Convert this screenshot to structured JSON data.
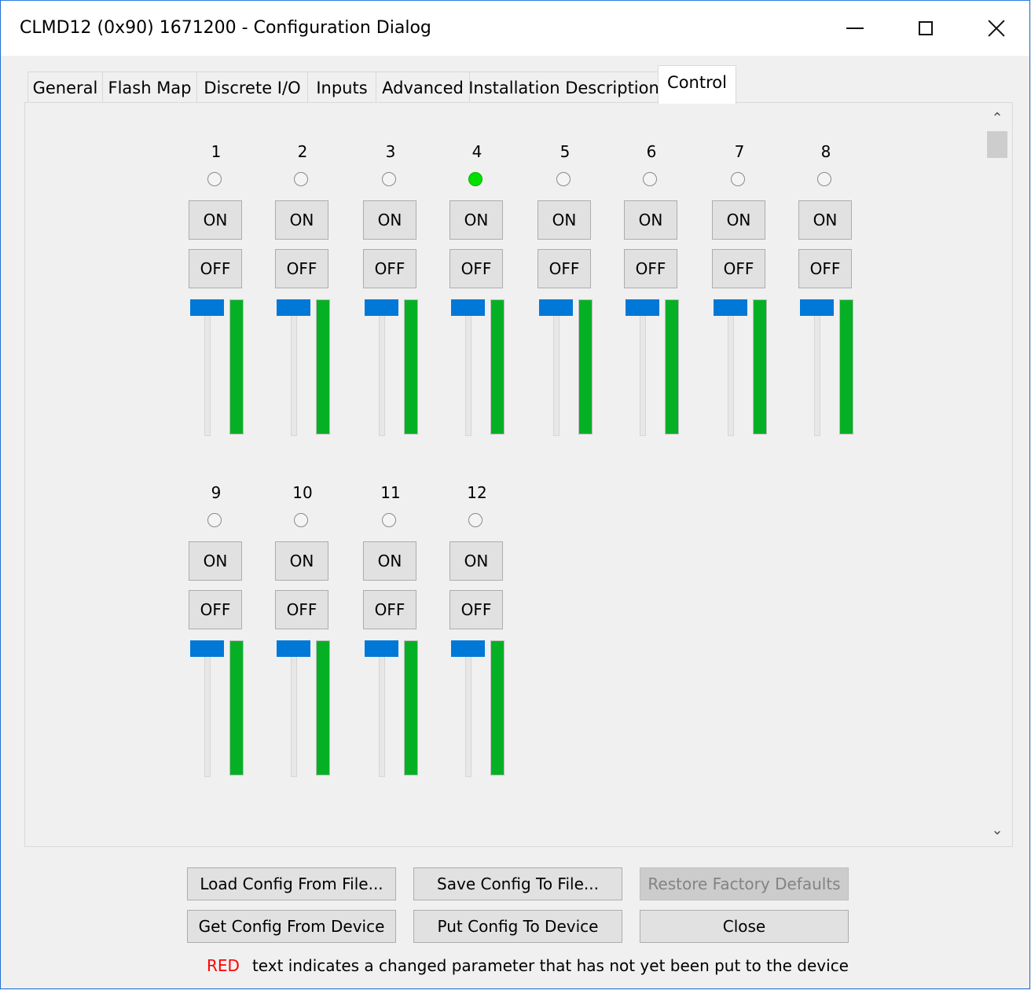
{
  "window": {
    "title": "CLMD12 (0x90) 1671200 - Configuration Dialog"
  },
  "tabs": [
    {
      "label": "General"
    },
    {
      "label": "Flash Map"
    },
    {
      "label": "Discrete I/O"
    },
    {
      "label": "Inputs"
    },
    {
      "label": "Advanced"
    },
    {
      "label": "Installation Description"
    },
    {
      "label": "Control",
      "active": true
    }
  ],
  "channels": [
    {
      "number": "1",
      "led_on": false,
      "on_label": "ON",
      "off_label": "OFF",
      "slider_level": 1.0,
      "output_level": 1.0
    },
    {
      "number": "2",
      "led_on": false,
      "on_label": "ON",
      "off_label": "OFF",
      "slider_level": 1.0,
      "output_level": 1.0
    },
    {
      "number": "3",
      "led_on": false,
      "on_label": "ON",
      "off_label": "OFF",
      "slider_level": 1.0,
      "output_level": 1.0
    },
    {
      "number": "4",
      "led_on": true,
      "on_label": "ON",
      "off_label": "OFF",
      "slider_level": 1.0,
      "output_level": 1.0
    },
    {
      "number": "5",
      "led_on": false,
      "on_label": "ON",
      "off_label": "OFF",
      "slider_level": 1.0,
      "output_level": 1.0
    },
    {
      "number": "6",
      "led_on": false,
      "on_label": "ON",
      "off_label": "OFF",
      "slider_level": 1.0,
      "output_level": 1.0
    },
    {
      "number": "7",
      "led_on": false,
      "on_label": "ON",
      "off_label": "OFF",
      "slider_level": 1.0,
      "output_level": 1.0
    },
    {
      "number": "8",
      "led_on": false,
      "on_label": "ON",
      "off_label": "OFF",
      "slider_level": 1.0,
      "output_level": 1.0
    },
    {
      "number": "9",
      "led_on": false,
      "on_label": "ON",
      "off_label": "OFF",
      "slider_level": 1.0,
      "output_level": 1.0
    },
    {
      "number": "10",
      "led_on": false,
      "on_label": "ON",
      "off_label": "OFF",
      "slider_level": 1.0,
      "output_level": 1.0
    },
    {
      "number": "11",
      "led_on": false,
      "on_label": "ON",
      "off_label": "OFF",
      "slider_level": 1.0,
      "output_level": 1.0
    },
    {
      "number": "12",
      "led_on": false,
      "on_label": "ON",
      "off_label": "OFF",
      "slider_level": 1.0,
      "output_level": 1.0
    }
  ],
  "buttons": {
    "load_config": "Load Config From File...",
    "save_config": "Save Config To File...",
    "restore_defaults": "Restore Factory Defaults",
    "get_config": "Get Config From Device",
    "put_config": "Put Config To Device",
    "close": "Close"
  },
  "footnote": {
    "red_word": "RED",
    "text": "text indicates a changed parameter that has not yet been put to the device"
  },
  "colors": {
    "led_on": "#00e000",
    "slider_thumb": "#0078d7",
    "level_fill": "#06b025",
    "changed_text": "#ff0000",
    "window_border": "#1f6fd0"
  },
  "icons": {
    "minimize": "minimize-icon",
    "maximize": "maximize-icon",
    "close": "close-icon",
    "scroll_up": "chevron-up-icon",
    "scroll_down": "chevron-down-icon"
  }
}
